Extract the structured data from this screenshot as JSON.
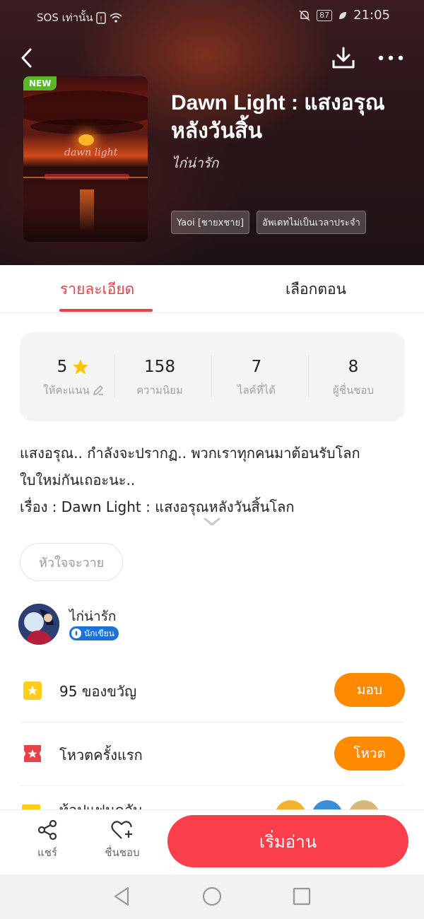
{
  "status_bar": {
    "carrier": "SOS เท่านั้น",
    "battery": "87",
    "time": "21:05"
  },
  "book": {
    "title": "Dawn Light : แสงอรุณหลังวันสิ้น",
    "author": "ไก่น่ารัก",
    "new_badge": "NEW",
    "cover_script": "dawn light",
    "tags": [
      "Yaoi [ชายxชาย]",
      "อัพเดทไม่เป็นเวลาประจำ"
    ]
  },
  "tabs": {
    "details": "รายละเอียด",
    "episodes": "เลือกตอน"
  },
  "stats": [
    {
      "value": "5",
      "label": "ให้คะแนน"
    },
    {
      "value": "158",
      "label": "ความนิยม"
    },
    {
      "value": "7",
      "label": "ไลค์ที่ได้"
    },
    {
      "value": "8",
      "label": "ผู้ชื่นชอบ"
    }
  ],
  "description": {
    "line1": "แสงอรุณ.. กำลังจะปรากฏ.. พวกเราทุกคนมาต้อนรับโลก",
    "line2": "ใบใหม่กันเถอะนะ..",
    "line3": "เรื่อง : Dawn Light : แสงอรุณหลังวันสิ้นโลก"
  },
  "chip": "หัวใจจะวาย",
  "author_row": {
    "name": "ไก่น่ารัก",
    "badge": "นักเขียน"
  },
  "rows": [
    {
      "label": "95 ของขวัญ",
      "button": "มอบ"
    },
    {
      "label": "โหวตครั้งแรก",
      "button": "โหวต"
    }
  ],
  "partial_row": {
    "label": "ท้อปแฟนคลับ"
  },
  "bottom_bar": {
    "share": "แชร์",
    "like": "ชื่นชอบ",
    "start": "เริ่มอ่าน"
  },
  "colors": {
    "accent": "#fa3e4b",
    "tab_active": "#e8414b",
    "action": "#ff8a00",
    "new_badge": "#58b82a",
    "writer_badge": "#1a73d9"
  }
}
